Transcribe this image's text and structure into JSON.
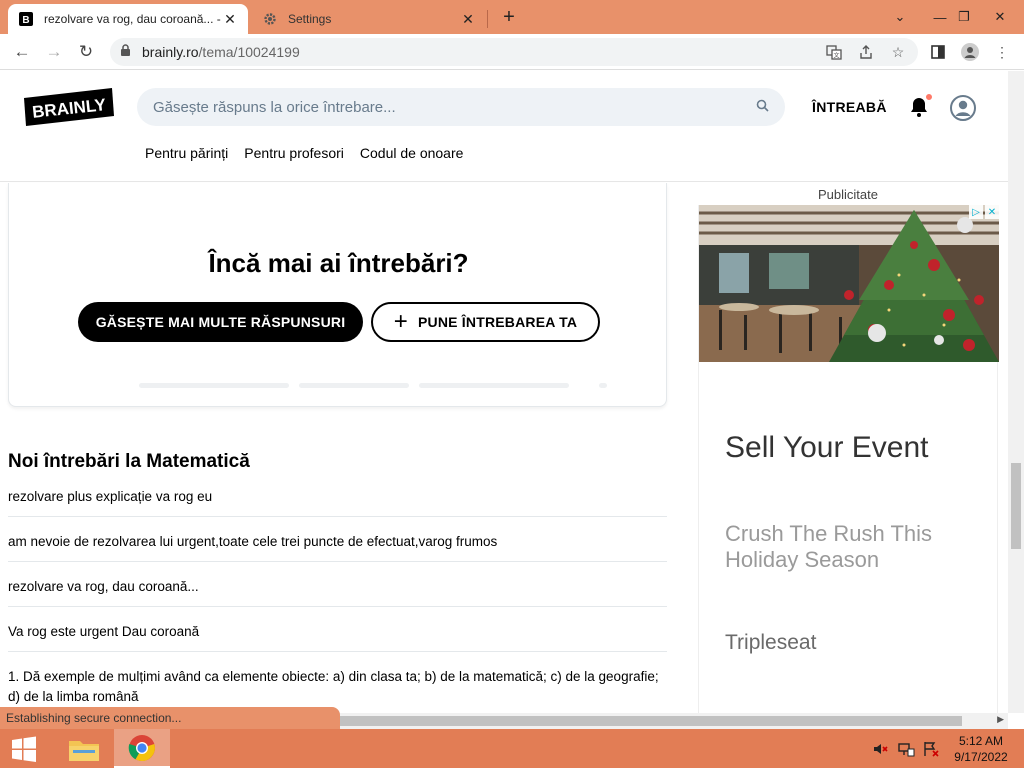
{
  "browser": {
    "tabs": [
      {
        "title": "rezolvare va rog, dau coroană... -",
        "favicon": "brainly-favicon",
        "active": true
      },
      {
        "title": "Settings",
        "favicon": "gear-icon",
        "active": false
      }
    ],
    "address": {
      "host": "brainly.ro",
      "path": "/tema/10024199"
    }
  },
  "site": {
    "logo_text": "BRAINLY",
    "search_placeholder": "Găsește răspuns la orice întrebare...",
    "ask_label": "ÎNTREABĂ",
    "subnav": [
      "Pentru părinți",
      "Pentru profesori",
      "Codul de onoare"
    ]
  },
  "cta": {
    "heading": "Încă mai ai întrebări?",
    "find_more_label": "GĂSEȘTE MAI MULTE RĂSPUNSURI",
    "ask_label": "PUNE ÎNTREBAREA TA"
  },
  "new_questions": {
    "title": "Noi întrebări la Matematică",
    "items": [
      "rezolvare plus explicație va rog eu",
      "am nevoie de rezolvarea lui urgent,toate cele trei puncte de efectuat,varog frumos",
      "rezolvare va rog, dau coroană...",
      "Va rog este urgent Dau coroană",
      "1. Dă exemple de mulțimi având ca elemente obiecte: a) din clasa ta; b) de la matematică; c) de la geografie; d) de la limba română"
    ]
  },
  "ad": {
    "label": "Publicitate",
    "title": "Sell Your Event",
    "subtitle": "Crush The Rush This Holiday Season",
    "brand": "Tripleseat"
  },
  "status_bar": "Establishing secure connection...",
  "taskbar": {
    "time": "5:12 AM",
    "date": "9/17/2022"
  },
  "colors": {
    "chrome_frame": "#e8916a",
    "taskbar": "#e27d55",
    "brainly_black": "#000000"
  }
}
